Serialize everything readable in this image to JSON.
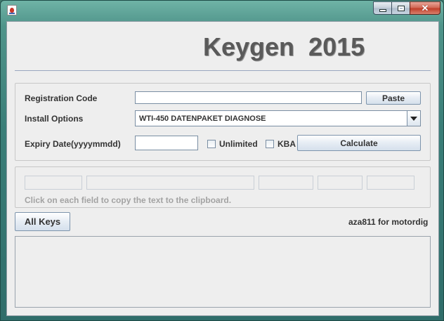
{
  "window": {
    "title": "",
    "controls": {
      "minimize_icon": "minimize-icon",
      "maximize_icon": "maximize-icon",
      "close_icon": "close-icon",
      "close_glyph": "✕"
    }
  },
  "header": {
    "title": "Keygen  2015"
  },
  "form": {
    "registration_label": "Registration Code",
    "registration_value": "",
    "paste_label": "Paste",
    "install_label": "Install Options",
    "install_selected": "WTI-450 DATENPAKET DIAGNOSE",
    "expiry_label": "Expiry Date(yyyymmdd)",
    "expiry_value": "",
    "unlimited_label": "Unlimited",
    "unlimited_checked": false,
    "kba_label": "KBA",
    "kba_checked": false,
    "calculate_label": "Calculate"
  },
  "output": {
    "fields": [
      "",
      "",
      "",
      "",
      ""
    ],
    "hint": "Click on each field to copy the text to the clipboard."
  },
  "footer": {
    "all_keys_label": "All Keys",
    "credit": "aza811 for motordig",
    "log_text": ""
  }
}
